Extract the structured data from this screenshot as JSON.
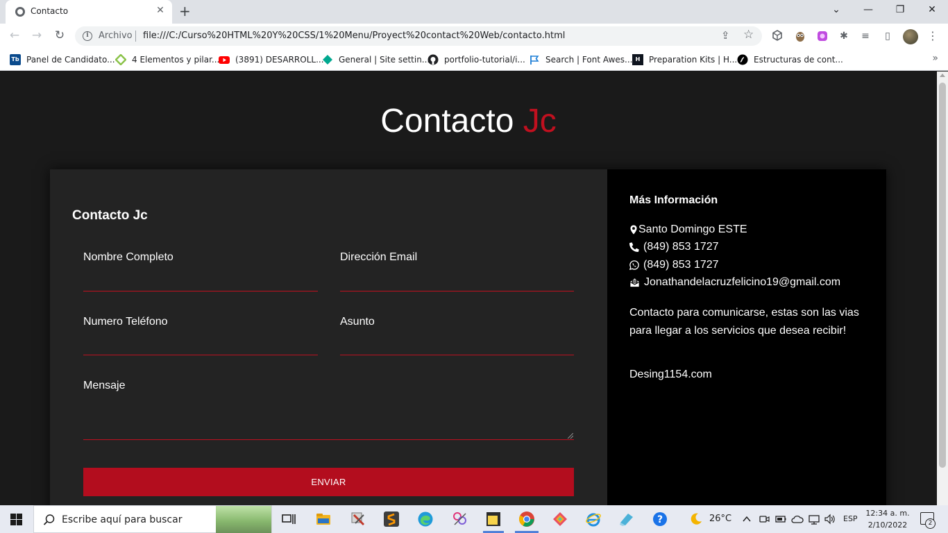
{
  "browser": {
    "tab": {
      "title": "Contacto",
      "close_glyph": "✕",
      "favicon": "globe-icon"
    },
    "new_tab_glyph": "+",
    "window_controls": {
      "chevron": "⌄",
      "minimize": "—",
      "restore": "❐",
      "close": "✕"
    },
    "nav": {
      "back": "←",
      "forward": "→",
      "reload": "↻"
    },
    "omnibox": {
      "info_glyph": "i",
      "scheme_label": "Archivo",
      "url": "file:///C:/Curso%20HTML%20Y%20CSS/1%20Menu/Proyect%20contact%20Web/contacto.html",
      "share_glyph": "⇪",
      "star_glyph": "☆"
    },
    "extensions": {
      "puzzle": "✱",
      "playlist": "≡",
      "sidebar": "▯",
      "menu": "⋮"
    },
    "bookmarks": [
      {
        "label": "Panel de Candidato...",
        "icon": "tb-icon",
        "color": "#0a4a8c"
      },
      {
        "label": "4 Elementos y pilar...",
        "icon": "diamond-icon",
        "color": "#8bc34a"
      },
      {
        "label": "(3891) DESARROLL...",
        "icon": "youtube-icon",
        "color": "#ff0000"
      },
      {
        "label": "General | Site settin...",
        "icon": "gem-icon",
        "color": "#00a88f"
      },
      {
        "label": "portfolio-tutorial/i...",
        "icon": "github-icon",
        "color": "#202124"
      },
      {
        "label": "Search | Font Awes...",
        "icon": "flag-icon",
        "color": "#1c7ed6"
      },
      {
        "label": "Preparation Kits | H...",
        "icon": "hackerrank-icon",
        "color": "#0e141e"
      },
      {
        "label": "Estructuras de cont...",
        "icon": "symfony-icon",
        "color": "#000000"
      }
    ],
    "bookmarks_more": "»"
  },
  "page": {
    "hero": {
      "title_main": "Contacto",
      "title_accent": "Jc"
    },
    "form": {
      "heading": "Contacto Jc",
      "fields": {
        "name": "Nombre Completo",
        "email": "Dirección Email",
        "phone": "Numero Teléfono",
        "subject": "Asunto",
        "message": "Mensaje"
      },
      "submit": "ENVIAR"
    },
    "info": {
      "heading": "Más Información",
      "location": "Santo Domingo ESTE",
      "phone": "(849) 853 1727",
      "whatsapp": "(849) 853 1727",
      "email": "Jonathandelacruzfelicino19@gmail.com",
      "description": "Contacto para comunicarse, estas son las vias para llegar a los servicios que desea recibir!",
      "website": "Desing1154.com"
    }
  },
  "colors": {
    "accent": "#c0101f",
    "button": "#b30d1e",
    "page_bg": "#1a1a1a",
    "form_bg": "#232323",
    "info_bg": "#000000"
  },
  "taskbar": {
    "search_placeholder": "Escribe aquí para buscar",
    "weather": "26°C",
    "language": "ESP",
    "time": "12:34 a. m.",
    "date": "2/10/2022",
    "notifications": "2"
  }
}
